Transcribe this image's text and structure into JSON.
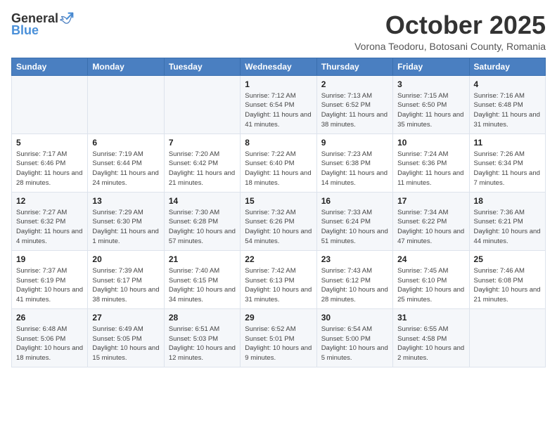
{
  "logo": {
    "general": "General",
    "blue": "Blue"
  },
  "title": "October 2025",
  "subtitle": "Vorona Teodoru, Botosani County, Romania",
  "days_header": [
    "Sunday",
    "Monday",
    "Tuesday",
    "Wednesday",
    "Thursday",
    "Friday",
    "Saturday"
  ],
  "weeks": [
    [
      {
        "day": "",
        "info": ""
      },
      {
        "day": "",
        "info": ""
      },
      {
        "day": "",
        "info": ""
      },
      {
        "day": "1",
        "info": "Sunrise: 7:12 AM\nSunset: 6:54 PM\nDaylight: 11 hours and 41 minutes."
      },
      {
        "day": "2",
        "info": "Sunrise: 7:13 AM\nSunset: 6:52 PM\nDaylight: 11 hours and 38 minutes."
      },
      {
        "day": "3",
        "info": "Sunrise: 7:15 AM\nSunset: 6:50 PM\nDaylight: 11 hours and 35 minutes."
      },
      {
        "day": "4",
        "info": "Sunrise: 7:16 AM\nSunset: 6:48 PM\nDaylight: 11 hours and 31 minutes."
      }
    ],
    [
      {
        "day": "5",
        "info": "Sunrise: 7:17 AM\nSunset: 6:46 PM\nDaylight: 11 hours and 28 minutes."
      },
      {
        "day": "6",
        "info": "Sunrise: 7:19 AM\nSunset: 6:44 PM\nDaylight: 11 hours and 24 minutes."
      },
      {
        "day": "7",
        "info": "Sunrise: 7:20 AM\nSunset: 6:42 PM\nDaylight: 11 hours and 21 minutes."
      },
      {
        "day": "8",
        "info": "Sunrise: 7:22 AM\nSunset: 6:40 PM\nDaylight: 11 hours and 18 minutes."
      },
      {
        "day": "9",
        "info": "Sunrise: 7:23 AM\nSunset: 6:38 PM\nDaylight: 11 hours and 14 minutes."
      },
      {
        "day": "10",
        "info": "Sunrise: 7:24 AM\nSunset: 6:36 PM\nDaylight: 11 hours and 11 minutes."
      },
      {
        "day": "11",
        "info": "Sunrise: 7:26 AM\nSunset: 6:34 PM\nDaylight: 11 hours and 7 minutes."
      }
    ],
    [
      {
        "day": "12",
        "info": "Sunrise: 7:27 AM\nSunset: 6:32 PM\nDaylight: 11 hours and 4 minutes."
      },
      {
        "day": "13",
        "info": "Sunrise: 7:29 AM\nSunset: 6:30 PM\nDaylight: 11 hours and 1 minute."
      },
      {
        "day": "14",
        "info": "Sunrise: 7:30 AM\nSunset: 6:28 PM\nDaylight: 10 hours and 57 minutes."
      },
      {
        "day": "15",
        "info": "Sunrise: 7:32 AM\nSunset: 6:26 PM\nDaylight: 10 hours and 54 minutes."
      },
      {
        "day": "16",
        "info": "Sunrise: 7:33 AM\nSunset: 6:24 PM\nDaylight: 10 hours and 51 minutes."
      },
      {
        "day": "17",
        "info": "Sunrise: 7:34 AM\nSunset: 6:22 PM\nDaylight: 10 hours and 47 minutes."
      },
      {
        "day": "18",
        "info": "Sunrise: 7:36 AM\nSunset: 6:21 PM\nDaylight: 10 hours and 44 minutes."
      }
    ],
    [
      {
        "day": "19",
        "info": "Sunrise: 7:37 AM\nSunset: 6:19 PM\nDaylight: 10 hours and 41 minutes."
      },
      {
        "day": "20",
        "info": "Sunrise: 7:39 AM\nSunset: 6:17 PM\nDaylight: 10 hours and 38 minutes."
      },
      {
        "day": "21",
        "info": "Sunrise: 7:40 AM\nSunset: 6:15 PM\nDaylight: 10 hours and 34 minutes."
      },
      {
        "day": "22",
        "info": "Sunrise: 7:42 AM\nSunset: 6:13 PM\nDaylight: 10 hours and 31 minutes."
      },
      {
        "day": "23",
        "info": "Sunrise: 7:43 AM\nSunset: 6:12 PM\nDaylight: 10 hours and 28 minutes."
      },
      {
        "day": "24",
        "info": "Sunrise: 7:45 AM\nSunset: 6:10 PM\nDaylight: 10 hours and 25 minutes."
      },
      {
        "day": "25",
        "info": "Sunrise: 7:46 AM\nSunset: 6:08 PM\nDaylight: 10 hours and 21 minutes."
      }
    ],
    [
      {
        "day": "26",
        "info": "Sunrise: 6:48 AM\nSunset: 5:06 PM\nDaylight: 10 hours and 18 minutes."
      },
      {
        "day": "27",
        "info": "Sunrise: 6:49 AM\nSunset: 5:05 PM\nDaylight: 10 hours and 15 minutes."
      },
      {
        "day": "28",
        "info": "Sunrise: 6:51 AM\nSunset: 5:03 PM\nDaylight: 10 hours and 12 minutes."
      },
      {
        "day": "29",
        "info": "Sunrise: 6:52 AM\nSunset: 5:01 PM\nDaylight: 10 hours and 9 minutes."
      },
      {
        "day": "30",
        "info": "Sunrise: 6:54 AM\nSunset: 5:00 PM\nDaylight: 10 hours and 5 minutes."
      },
      {
        "day": "31",
        "info": "Sunrise: 6:55 AM\nSunset: 4:58 PM\nDaylight: 10 hours and 2 minutes."
      },
      {
        "day": "",
        "info": ""
      }
    ]
  ]
}
